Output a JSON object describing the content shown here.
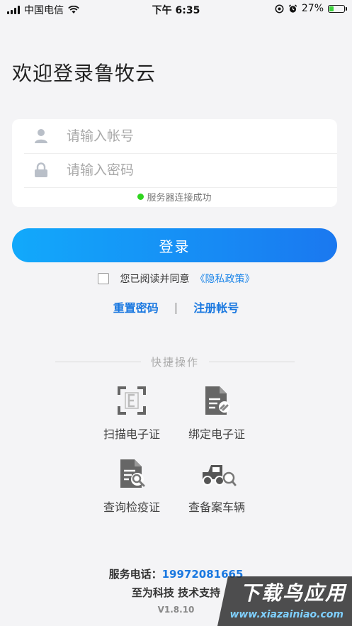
{
  "status_bar": {
    "carrier": "中国电信",
    "time": "下午 6:35",
    "battery": "27%",
    "battery_level": 0.27
  },
  "title": "欢迎登录鲁牧云",
  "form": {
    "account_placeholder": "请输入帐号",
    "password_placeholder": "请输入密码",
    "connection_status": "服务器连接成功",
    "connection_color": "#2fd51f"
  },
  "login_button": "登录",
  "agreement": {
    "text": "您已阅读并同意",
    "policy": "《隐私政策》",
    "checked": false
  },
  "links": {
    "reset": "重置密码",
    "separator": "|",
    "register": "注册帐号"
  },
  "quick_actions": {
    "heading": "快捷操作",
    "items": [
      {
        "label": "扫描电子证",
        "icon": "scan-e-icon"
      },
      {
        "label": "绑定电子证",
        "icon": "bind-doc-icon"
      },
      {
        "label": "查询检疫证",
        "icon": "search-doc-icon"
      },
      {
        "label": "查备案车辆",
        "icon": "truck-search-icon"
      }
    ]
  },
  "footer": {
    "phone_label": "服务电话：",
    "phone": "19972081665",
    "support": "至为科技 技术支持",
    "version": "V1.8.10"
  },
  "watermark": {
    "line1": "下载鸟应用",
    "line2": "www.xiazainiao.com"
  },
  "colors": {
    "accent": "#1a78e0",
    "button_start": "#12a9fb",
    "button_end": "#1a78f0"
  }
}
